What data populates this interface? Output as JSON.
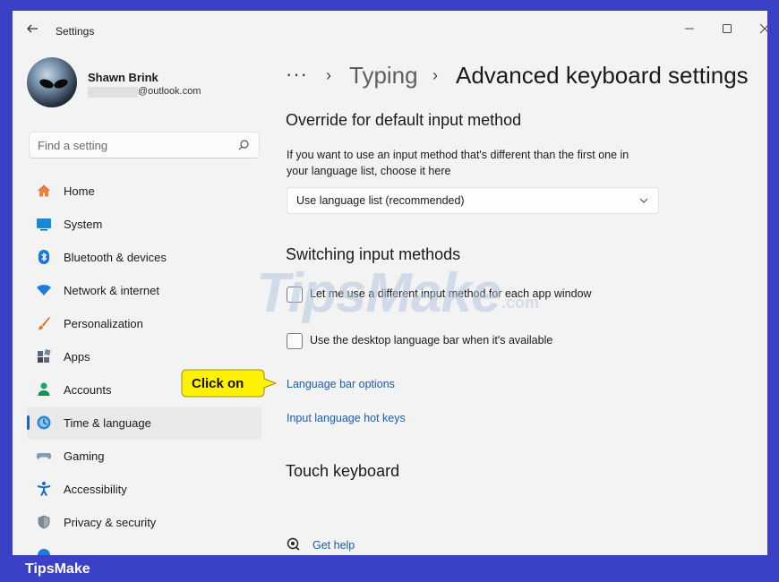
{
  "window": {
    "title": "Settings",
    "controls": {
      "minimize": "–",
      "maximize": "☐",
      "close": "✕"
    }
  },
  "profile": {
    "name": "Shawn Brink",
    "email": "@outlook.com"
  },
  "search": {
    "placeholder": "Find a setting"
  },
  "sidebar": {
    "items": [
      {
        "label": "Home",
        "icon": "home-icon"
      },
      {
        "label": "System",
        "icon": "system-icon"
      },
      {
        "label": "Bluetooth & devices",
        "icon": "bluetooth-icon"
      },
      {
        "label": "Network & internet",
        "icon": "wifi-icon"
      },
      {
        "label": "Personalization",
        "icon": "brush-icon"
      },
      {
        "label": "Apps",
        "icon": "apps-icon"
      },
      {
        "label": "Accounts",
        "icon": "accounts-icon"
      },
      {
        "label": "Time & language",
        "icon": "time-language-icon",
        "selected": true
      },
      {
        "label": "Gaming",
        "icon": "gamepad-icon"
      },
      {
        "label": "Accessibility",
        "icon": "accessibility-icon"
      },
      {
        "label": "Privacy & security",
        "icon": "shield-icon"
      }
    ]
  },
  "breadcrumb": {
    "more": "···",
    "separator": "›",
    "parent": "Typing",
    "current": "Advanced keyboard settings"
  },
  "override": {
    "heading": "Override for default input method",
    "desc_line1": "If you want to use an input method that's different than the first one in",
    "desc_line2": "your language list, choose it here",
    "dropdown_value": "Use language list (recommended)"
  },
  "switching": {
    "heading": "Switching input methods",
    "checkbox1": {
      "label": "Let me use a different input method for each app window",
      "checked": false
    },
    "checkbox2": {
      "label": "Use the desktop language bar when it's available",
      "checked": false
    },
    "link_language_bar": "Language bar options",
    "link_hot_keys": "Input language hot keys"
  },
  "touch": {
    "heading": "Touch keyboard"
  },
  "help": {
    "label": "Get help"
  },
  "callout": {
    "text": "Click on"
  },
  "watermark": {
    "main": "TipsMake",
    "suffix": ".com"
  },
  "footer": {
    "brand": "TipsMake"
  },
  "colors": {
    "accent": "#1f63c6",
    "link": "#1b5ea8",
    "frame": "#3a41c6",
    "callout": "#fff200"
  }
}
